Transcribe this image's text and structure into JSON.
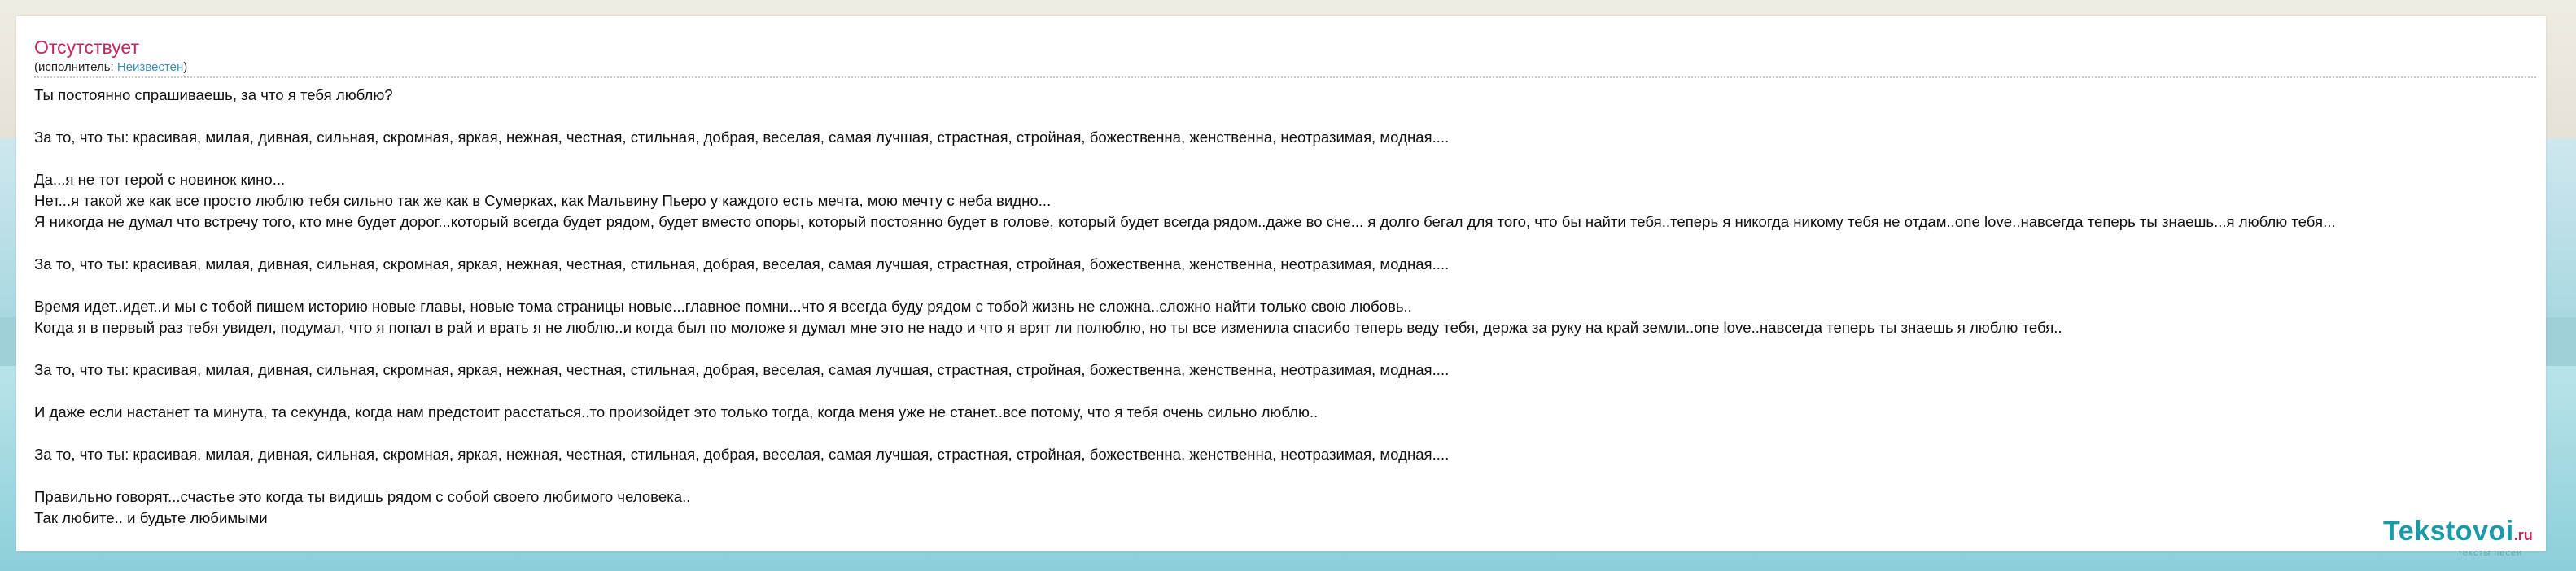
{
  "song": {
    "title": "Отсутствует",
    "performer_prefix": "(исполнитель: ",
    "performer_name": "Неизвестен",
    "performer_suffix": ")"
  },
  "lyrics": [
    "Ты постоянно спрашиваешь, за что я тебя люблю?",
    "",
    "За то, что ты: красивая, милая, дивная, сильная, скромная, яркая, нежная, честная, стильная, добрая, веселая, самая лучшая, страстная, стройная, божественна, женственна, неотразимая, модная....",
    "",
    "Да...я не тот герой с новинок кино...",
    "Нет...я такой же как все просто люблю тебя сильно так же как в Сумерках, как Мальвину Пьеро у каждого есть мечта, мою мечту с неба видно...",
    "Я никогда не думал что встречу того, кто мне будет дорог...который всегда будет рядом, будет вместо опоры, который постоянно будет в голове, который будет всегда рядом..даже во сне... я долго бегал для того, что бы найти тебя..теперь я никогда никому тебя не отдам..one love..навсегда теперь ты знаешь...я люблю тебя...",
    "",
    "За то, что ты: красивая, милая, дивная, сильная, скромная, яркая, нежная, честная, стильная, добрая, веселая, самая лучшая, страстная, стройная, божественна, женственна, неотразимая, модная....",
    "",
    "Время идет..идет..и мы с тобой пишем историю новые главы, новые тома страницы новые...главное помни...что я всегда буду рядом с тобой жизнь не сложна..сложно найти только свою любовь..",
    "Когда я в первый раз тебя увидел, подумал, что я попал в рай и врать я не люблю..и когда был по моложе я думал мне это не надо и что я врят ли полюблю, но ты все изменила спасибо теперь веду тебя, держа за руку на край земли..one love..навсегда теперь ты знаешь я люблю тебя..",
    "",
    "За то, что ты: красивая, милая, дивная, сильная, скромная, яркая, нежная, честная, стильная, добрая, веселая, самая лучшая, страстная, стройная, божественна, женственна, неотразимая, модная....",
    "",
    "И даже если настанет та минута, та секунда, когда нам предстоит расстаться..то произойдет это только тогда, когда меня уже не станет..все потому, что я тебя очень сильно люблю..",
    "",
    "За то, что ты: красивая, милая, дивная, сильная, скромная, яркая, нежная, честная, стильная, добрая, веселая, самая лучшая, страстная, стройная, божественна, женственна, неотразимая, модная....",
    "",
    "Правильно говорят...счастье это когда ты видишь рядом с собой своего любимого человека..",
    "Так любите.. и будьте любимыми"
  ],
  "logo": {
    "name": "Tekstovoi",
    "tld": ".ru",
    "tagline": "тексты песен"
  }
}
